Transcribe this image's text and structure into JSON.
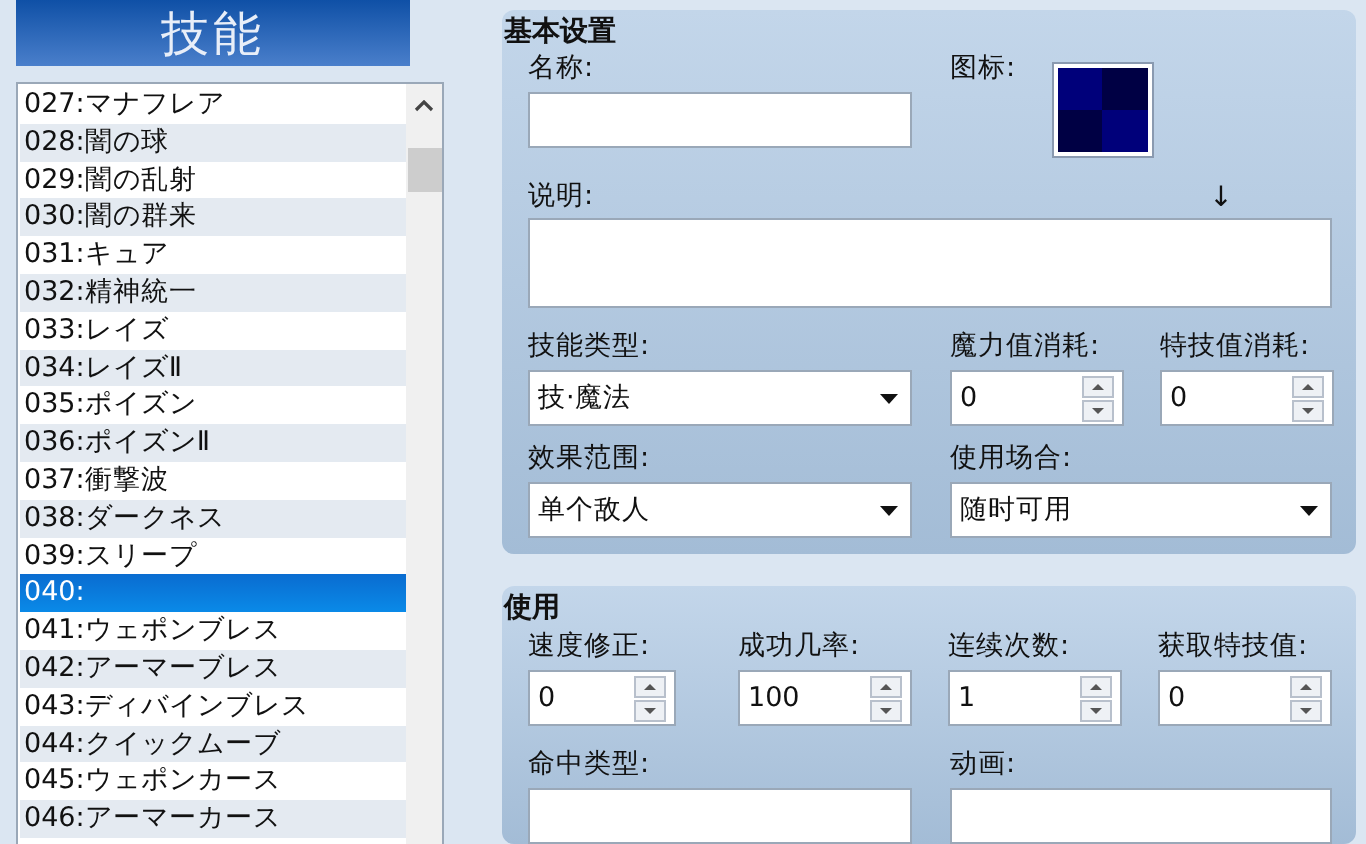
{
  "header": {
    "title": "技能"
  },
  "skill_list": {
    "items": [
      {
        "label": "027:マナフレア",
        "selected": false
      },
      {
        "label": "028:闇の球",
        "selected": false
      },
      {
        "label": "029:闇の乱射",
        "selected": false
      },
      {
        "label": "030:闇の群来",
        "selected": false
      },
      {
        "label": "031:キュア",
        "selected": false
      },
      {
        "label": "032:精神統一",
        "selected": false
      },
      {
        "label": "033:レイズ",
        "selected": false
      },
      {
        "label": "034:レイズⅡ",
        "selected": false
      },
      {
        "label": "035:ポイズン",
        "selected": false
      },
      {
        "label": "036:ポイズンⅡ",
        "selected": false
      },
      {
        "label": "037:衝撃波",
        "selected": false
      },
      {
        "label": "038:ダークネス",
        "selected": false
      },
      {
        "label": "039:スリープ",
        "selected": false
      },
      {
        "label": "040:",
        "selected": true
      },
      {
        "label": "041:ウェポンブレス",
        "selected": false
      },
      {
        "label": "042:アーマーブレス",
        "selected": false
      },
      {
        "label": "043:ディバインブレス",
        "selected": false
      },
      {
        "label": "044:クイックムーブ",
        "selected": false
      },
      {
        "label": "045:ウェポンカース",
        "selected": false
      },
      {
        "label": "046:アーマーカース",
        "selected": false
      }
    ]
  },
  "basic_settings": {
    "title": "基本设置",
    "name": {
      "label": "名称:"
    },
    "icon": {
      "label": "图标:"
    },
    "description": {
      "label": "说明:",
      "marker": "↓"
    },
    "skill_type": {
      "label": "技能类型:",
      "value": "技·魔法"
    },
    "mp_cost": {
      "label": "魔力值消耗:",
      "value": "0"
    },
    "tp_cost": {
      "label": "特技值消耗:",
      "value": "0"
    },
    "scope": {
      "label": "效果范围:",
      "value": "单个敌人"
    },
    "occasion": {
      "label": "使用场合:",
      "value": "随时可用"
    }
  },
  "invocation": {
    "title": "使用",
    "spinners": [
      {
        "label": "速度修正:",
        "value": "0"
      },
      {
        "label": "成功几率:",
        "value": "100"
      },
      {
        "label": "连续次数:",
        "value": "1"
      },
      {
        "label": "获取特技值:",
        "value": "0"
      }
    ],
    "hit_type": {
      "label": "命中类型:"
    },
    "animation": {
      "label": "动画:"
    }
  }
}
